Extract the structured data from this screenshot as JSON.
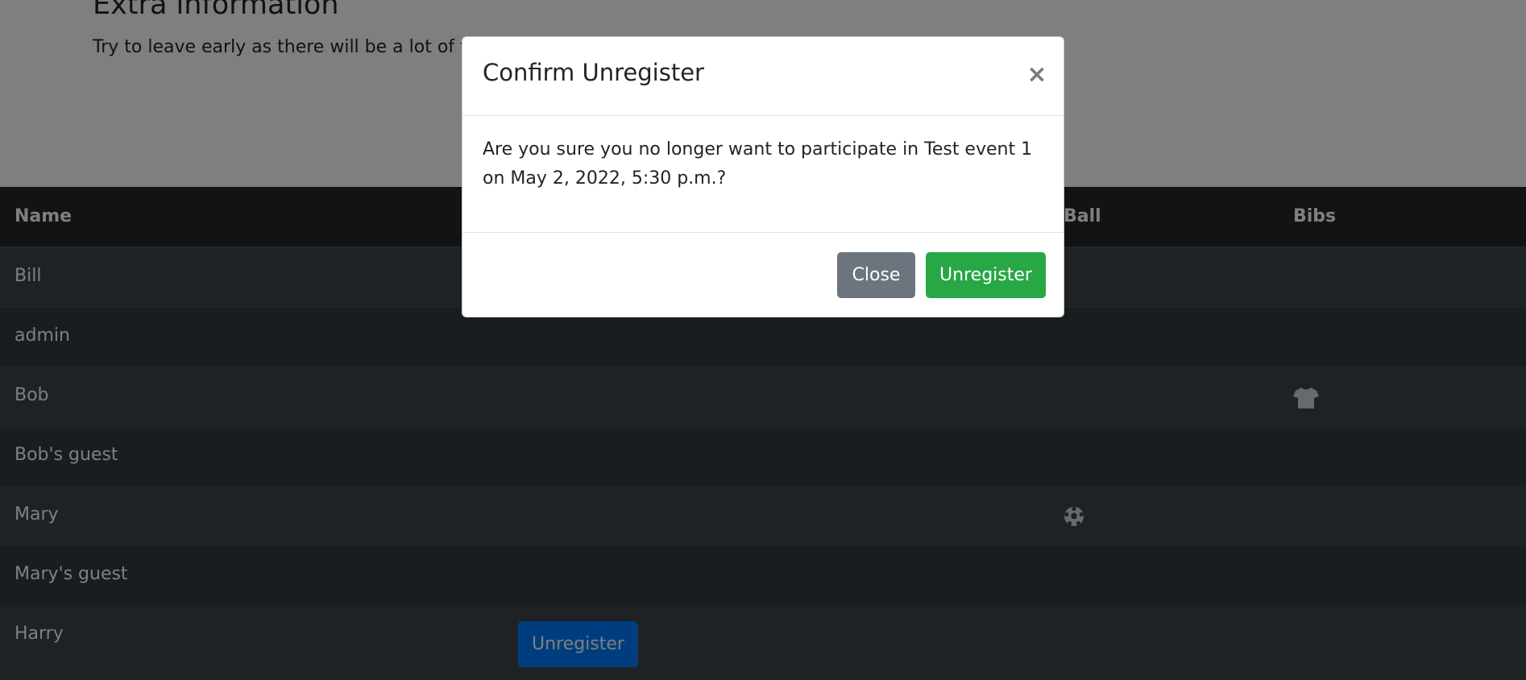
{
  "page": {
    "extra_heading": "Extra information",
    "extra_text": "Try to leave early as there will be a lot of traffic on the roads."
  },
  "table": {
    "headers": {
      "name": "Name",
      "ball": "Ball",
      "bibs": "Bibs"
    },
    "rows": [
      {
        "name": "Bill"
      },
      {
        "name": "admin"
      },
      {
        "name": "Bob",
        "bibs_icon": "shirt-icon"
      },
      {
        "name": "Bob's guest"
      },
      {
        "name": "Mary",
        "ball_icon": "soccer-ball-icon"
      },
      {
        "name": "Mary's guest"
      },
      {
        "name": "Harry",
        "action_label": "Unregister"
      }
    ]
  },
  "modal": {
    "title": "Confirm Unregister",
    "close_symbol": "×",
    "body": "Are you sure you no longer want to participate in Test event 1 on May 2, 2022, 5:30 p.m.?",
    "close_button": "Close",
    "unregister_button": "Unregister"
  },
  "colors": {
    "primary": "#007bff",
    "success": "#28a745",
    "secondary": "#6c757d",
    "table_dark": "#343a40"
  }
}
